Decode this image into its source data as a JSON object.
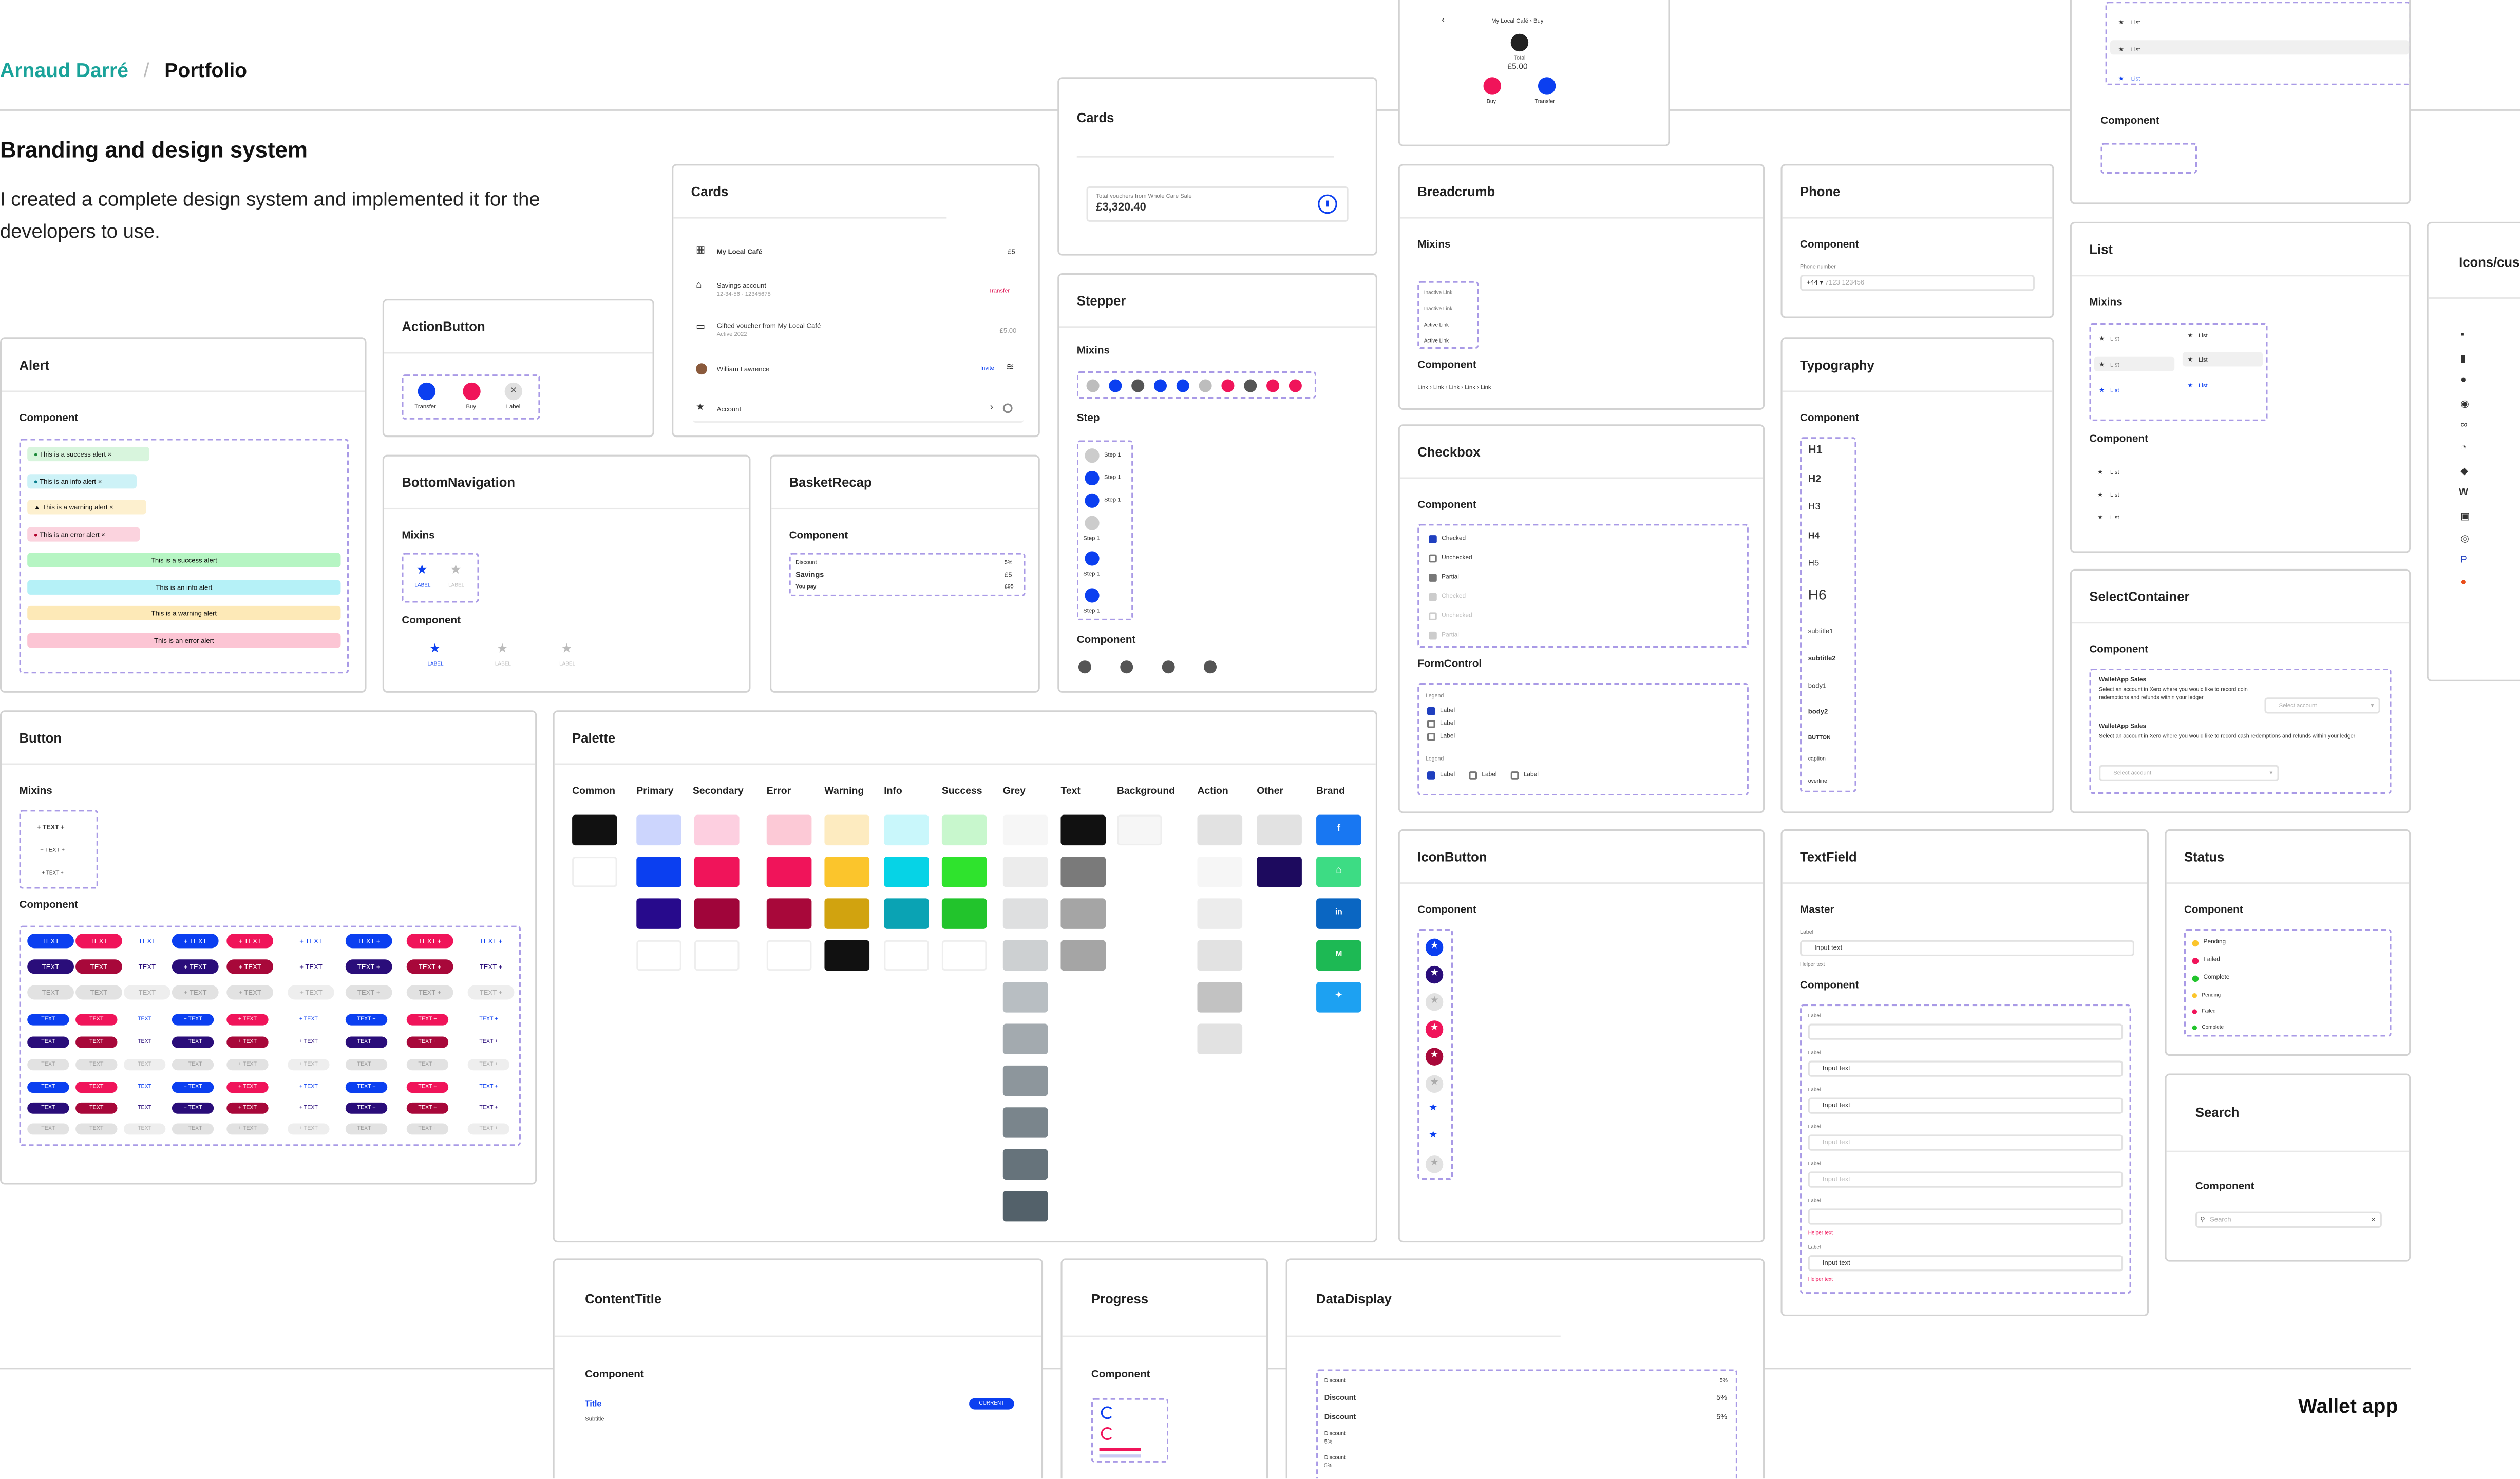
{
  "header": {
    "author": "Arnaud Darré",
    "separator": "/",
    "section": "Portfolio"
  },
  "intro": {
    "title": "Branding and design system",
    "description": "I created a complete design system and implemented it for the developers to use."
  },
  "footer": {
    "project": "Wallet app"
  },
  "common": {
    "component": "Component",
    "mixins": "Mixins",
    "text": "TEXT",
    "label": "LABEL",
    "label_case": "Label",
    "list": "List",
    "input_text": "Input text",
    "helper_text": "Helper text"
  },
  "alert": {
    "title": "Alert",
    "items": [
      "This is a success alert",
      "This is an info alert",
      "This is a warning alert",
      "This is an error alert"
    ],
    "banners": [
      "This is a success alert",
      "This is an info alert",
      "This is a warning alert",
      "This is an error alert"
    ]
  },
  "action_button": {
    "title": "ActionButton",
    "labels": [
      "Transfer",
      "Buy",
      "Label"
    ]
  },
  "cards_a": {
    "title": "Cards",
    "rows": [
      {
        "label": "My Local Café",
        "value": "£5"
      },
      {
        "label": "Savings account",
        "sub": "12-34-56 · 12345678",
        "value": "Transfer"
      },
      {
        "label": "Gifted voucher from My Local Café",
        "sub": "Active 2022",
        "value": "£5.00"
      },
      {
        "label": "William Lawrence",
        "value": "Invite"
      },
      {
        "label": "Account",
        "value": "›"
      }
    ]
  },
  "cards_b": {
    "title": "Cards",
    "caption": "Total vouchers from Whole Care Sale",
    "amount": "£3,320.40"
  },
  "bottom_nav": {
    "title": "BottomNavigation"
  },
  "basket": {
    "title": "BasketRecap",
    "rows": [
      {
        "label": "Discount",
        "value": "5%"
      },
      {
        "label": "Savings",
        "value": "£5"
      },
      {
        "label": "You pay",
        "value": "£95"
      }
    ]
  },
  "stepper": {
    "title": "Stepper",
    "step_section": "Step",
    "steps": [
      "Step 1",
      "Step 1",
      "Step 1",
      "Step 1",
      "Step 1",
      "Step 1"
    ]
  },
  "pay": {
    "breadcrumb": "My Local Café › Buy",
    "total_label": "Total",
    "total": "£5.00",
    "buttons": [
      "Buy",
      "Transfer"
    ]
  },
  "breadcrumb": {
    "title": "Breadcrumb",
    "trail": [
      "Link",
      "Link",
      "Link",
      "Link",
      "Link"
    ],
    "links": [
      "Inactive Link",
      "Inactive Link",
      "Active Link",
      "Active Link"
    ]
  },
  "phone": {
    "title": "Phone",
    "field_label": "Phone number",
    "code": "+44",
    "placeholder": "7123 123456"
  },
  "typography": {
    "title": "Typography",
    "styles": [
      "H1",
      "H2",
      "H3",
      "H4",
      "H5",
      "H6",
      "subtitle1",
      "subtitle2",
      "body1",
      "body2",
      "BUTTON",
      "caption",
      "overline"
    ]
  },
  "checkbox": {
    "title": "Checkbox",
    "items": [
      "Checked",
      "Unchecked",
      "Partial",
      "Checked",
      "Unchecked",
      "Partial"
    ],
    "form_control": "FormControl",
    "legend": "Legend"
  },
  "list_top": {
    "title": "Component"
  },
  "list": {
    "title": "List"
  },
  "select": {
    "title": "SelectContainer",
    "blocks": [
      {
        "heading": "WalletApp Sales",
        "text": "Select an account in Xero where you would like to record coin redemptions and refunds within your ledger",
        "placeholder": "Select account"
      },
      {
        "heading": "WalletApp Sales",
        "text": "Select an account in Xero where you would like to record cash redemptions and refunds within your ledger",
        "placeholder": "Select account"
      }
    ]
  },
  "icons": {
    "title": "Icons/cus"
  },
  "button": {
    "title": "Button"
  },
  "palette": {
    "title": "Palette",
    "columns": [
      "Common",
      "Primary",
      "Secondary",
      "Error",
      "Warning",
      "Info",
      "Success",
      "Grey",
      "Text",
      "Background",
      "Action",
      "Other",
      "Brand"
    ]
  },
  "icon_button": {
    "title": "IconButton"
  },
  "textfield": {
    "title": "TextField",
    "master": "Master",
    "label": "Label"
  },
  "status": {
    "title": "Status",
    "items": [
      "Pending",
      "Failed",
      "Complete",
      "Pending",
      "Failed",
      "Complete"
    ]
  },
  "search": {
    "title": "Search",
    "placeholder": "Search"
  },
  "content_title": {
    "title": "ContentTitle",
    "item_title": "Title",
    "item_subtitle": "Subtitle",
    "badge": "CURRENT"
  },
  "progress": {
    "title": "Progress"
  },
  "data_display": {
    "title": "DataDisplay",
    "rows": [
      {
        "label": "Discount",
        "value": "5%"
      },
      {
        "label": "Discount",
        "value": "5%"
      },
      {
        "label": "Discount",
        "value": "5%"
      },
      {
        "label": "Discount",
        "value": ""
      },
      {
        "label": "5%",
        "value": ""
      },
      {
        "label": "Discount",
        "value": ""
      },
      {
        "label": "5%",
        "value": ""
      }
    ]
  },
  "colors": {
    "accent": "#1aa39a",
    "primary": "#0b3ff0",
    "secondary": "#f0145a",
    "dashed": "#a99ae6"
  },
  "brand_icons": [
    "f",
    "in",
    "M"
  ]
}
